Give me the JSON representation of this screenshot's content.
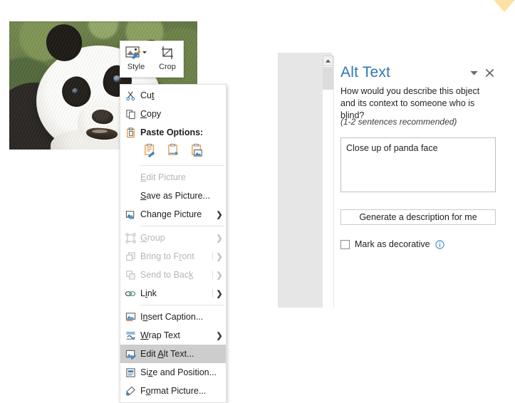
{
  "image": {
    "alt_subject": "panda-photo",
    "description": "Close up photo of a giant panda face with blurred green foliage background"
  },
  "mini_toolbar": {
    "items": [
      {
        "label": "Style",
        "icon": "picture-style-icon",
        "has_dropdown": true
      },
      {
        "label": "Crop",
        "icon": "crop-icon",
        "has_dropdown": false
      }
    ]
  },
  "context_menu": {
    "items": [
      {
        "id": "cut",
        "label": "Cut",
        "accel": "t",
        "icon": "scissors-icon",
        "disabled": false,
        "submenu": false,
        "bold": false
      },
      {
        "id": "copy",
        "label": "Copy",
        "accel": "C",
        "icon": "copy-icon",
        "disabled": false,
        "submenu": false,
        "bold": false
      },
      {
        "id": "paste-options",
        "label": "Paste Options:",
        "accel": "",
        "icon": "clipboard-icon",
        "disabled": false,
        "submenu": false,
        "bold": true
      },
      {
        "id": "paste-icons",
        "type": "icon-row",
        "icons": [
          "paste-keep-source-formatting-icon",
          "paste-merge-formatting-icon",
          "paste-picture-icon"
        ]
      },
      {
        "id": "sep1",
        "type": "separator"
      },
      {
        "id": "edit-picture",
        "label": "Edit Picture",
        "accel": "E",
        "icon": "",
        "disabled": true,
        "submenu": false,
        "bold": false
      },
      {
        "id": "save-as-picture",
        "label": "Save as Picture...",
        "accel": "S",
        "icon": "",
        "disabled": false,
        "submenu": false,
        "bold": false
      },
      {
        "id": "change-picture",
        "label": "Change Picture",
        "accel": "g",
        "icon": "change-picture-icon",
        "disabled": false,
        "submenu": true,
        "bold": false
      },
      {
        "id": "sep2",
        "type": "separator"
      },
      {
        "id": "group",
        "label": "Group",
        "accel": "G",
        "icon": "group-icon",
        "disabled": true,
        "submenu": true,
        "bold": false
      },
      {
        "id": "bring-to-front",
        "label": "Bring to Front",
        "accel": "r",
        "icon": "bring-to-front-icon",
        "disabled": true,
        "submenu": true,
        "divider": true,
        "bold": false
      },
      {
        "id": "send-to-back",
        "label": "Send to Back",
        "accel": "k",
        "icon": "send-to-back-icon",
        "disabled": true,
        "submenu": true,
        "divider": true,
        "bold": false
      },
      {
        "id": "link",
        "label": "Link",
        "accel": "i",
        "icon": "link-icon",
        "disabled": false,
        "submenu": true,
        "divider": true,
        "bold": false
      },
      {
        "id": "sep3",
        "type": "separator"
      },
      {
        "id": "insert-caption",
        "label": "Insert Caption...",
        "accel": "n",
        "icon": "insert-caption-icon",
        "disabled": false,
        "submenu": false,
        "bold": false
      },
      {
        "id": "wrap-text",
        "label": "Wrap Text",
        "accel": "W",
        "icon": "wrap-text-icon",
        "disabled": false,
        "submenu": true,
        "bold": false
      },
      {
        "id": "edit-alt-text",
        "label": "Edit Alt Text...",
        "accel": "A",
        "icon": "edit-alt-text-icon",
        "disabled": false,
        "submenu": false,
        "highlighted": true,
        "bold": false
      },
      {
        "id": "size-and-position",
        "label": "Size and Position...",
        "accel": "z",
        "icon": "size-and-position-icon",
        "disabled": false,
        "submenu": false,
        "bold": false
      },
      {
        "id": "format-picture",
        "label": "Format Picture...",
        "accel": "o",
        "icon": "format-picture-icon",
        "disabled": false,
        "submenu": false,
        "bold": false
      }
    ]
  },
  "alt_text_pane": {
    "title": "Alt Text",
    "title_color": "#2e75b6",
    "prompt": "How would you describe this object and its context to someone who is blind?",
    "hint": "(1-2 sentences recommended)",
    "description_value": "Close up of panda face",
    "description_placeholder": "",
    "generate_button_label": "Generate a description for me",
    "decorative_label": "Mark as decorative",
    "decorative_checked": false,
    "dropdown_icon": "chevron-down-icon",
    "close_icon": "close-icon",
    "info_icon": "info-icon",
    "scrollbar": {
      "up_arrow_icon": "scroll-up-arrow-icon"
    }
  },
  "decoration": {
    "corner_triangle_color": "#fce3a5"
  }
}
